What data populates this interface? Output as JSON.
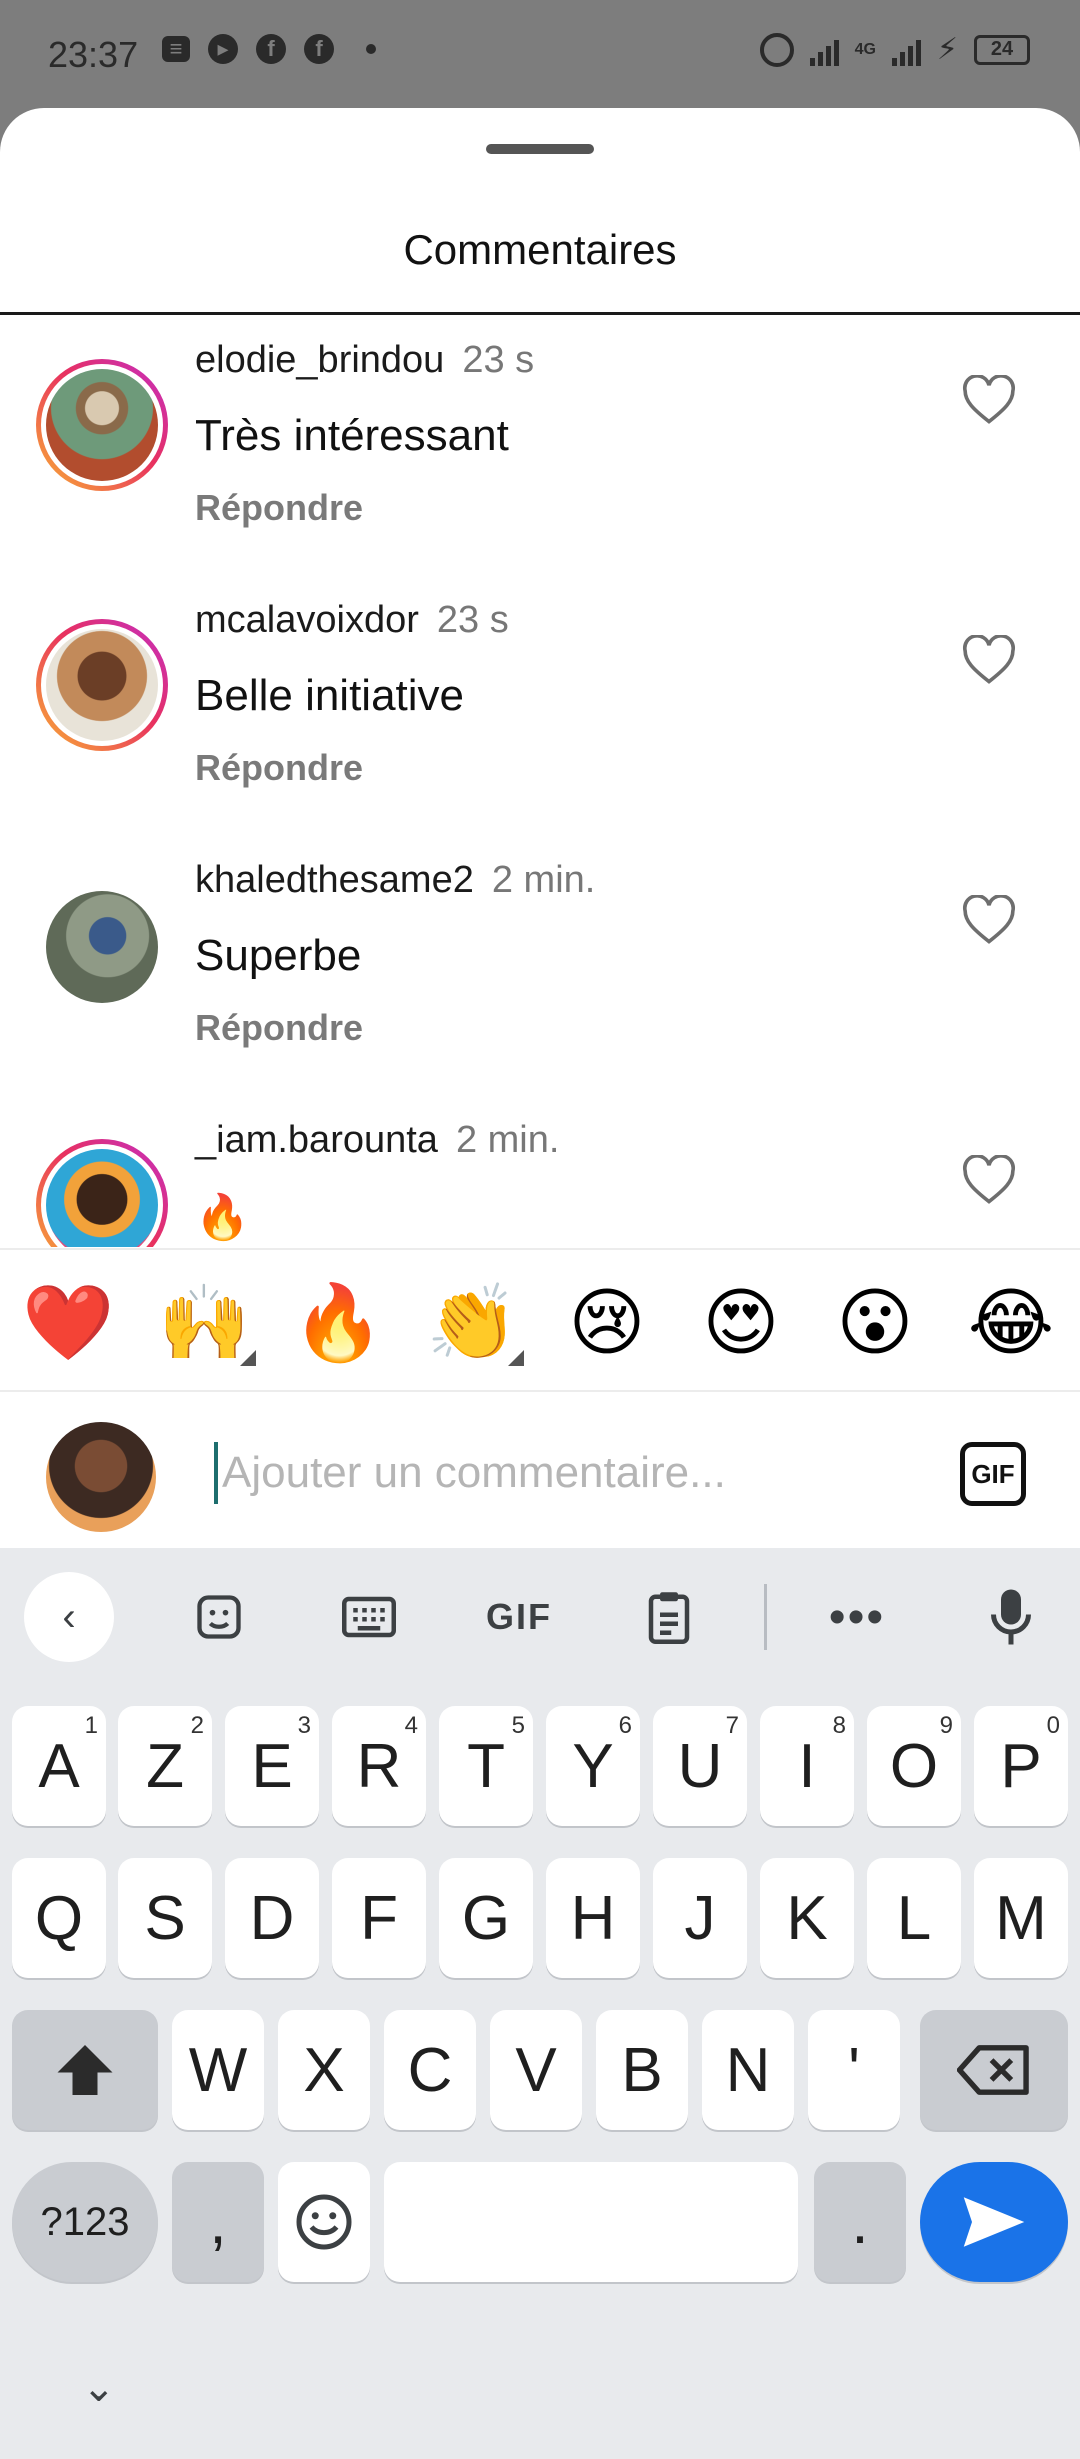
{
  "status_bar": {
    "time": "23:37",
    "left_icons": [
      "message-icon",
      "play-icon",
      "facebook-icon",
      "facebook-icon"
    ],
    "network": "4G",
    "battery": "24"
  },
  "sheet": {
    "title": "Commentaires"
  },
  "comments": [
    {
      "username": "elodie_brindou",
      "time": "23 s",
      "text": "Très intéressant",
      "reply": "Répondre",
      "ring": true
    },
    {
      "username": "mcalavoixdor",
      "time": "23 s",
      "text": "Belle initiative",
      "reply": "Répondre",
      "ring": true
    },
    {
      "username": "khaledthesame2",
      "time": "2 min.",
      "text": "Superbe",
      "reply": "Répondre",
      "ring": false
    },
    {
      "username": "_iam.barounta",
      "time": "2 min.",
      "text": "🔥",
      "reply": "",
      "ring": true
    }
  ],
  "emoji_bar": [
    "❤️",
    "🙌",
    "🔥",
    "👏",
    "😢",
    "😍",
    "😮",
    "😂"
  ],
  "comment_input": {
    "placeholder": "Ajouter un commentaire...",
    "gif_label": "GIF"
  },
  "keyboard": {
    "toolbar": [
      "back-icon",
      "sticker-icon",
      "keyboard-icon",
      "GIF",
      "clipboard-icon",
      "more-icon",
      "mic-icon"
    ],
    "gif_label": "GIF",
    "row1": [
      {
        "k": "A",
        "s": "1"
      },
      {
        "k": "Z",
        "s": "2"
      },
      {
        "k": "E",
        "s": "3"
      },
      {
        "k": "R",
        "s": "4"
      },
      {
        "k": "T",
        "s": "5"
      },
      {
        "k": "Y",
        "s": "6"
      },
      {
        "k": "U",
        "s": "7"
      },
      {
        "k": "I",
        "s": "8"
      },
      {
        "k": "O",
        "s": "9"
      },
      {
        "k": "P",
        "s": "0"
      }
    ],
    "row2": [
      "Q",
      "S",
      "D",
      "F",
      "G",
      "H",
      "J",
      "K",
      "L",
      "M"
    ],
    "row3": [
      "W",
      "X",
      "C",
      "V",
      "B",
      "N",
      "'"
    ],
    "row4": {
      "symbols": "?123",
      "comma": ",",
      "period": "."
    }
  }
}
